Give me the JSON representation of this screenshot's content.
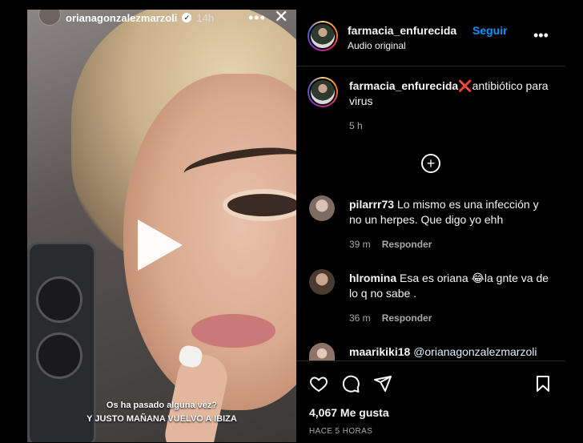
{
  "story": {
    "username": "orianagonzalezmarzoli",
    "time": "14h",
    "caption_line1": "Os ha pasado alguna vez?",
    "caption_line2": "Y JUSTO MAÑANA VUELVO A IBIZA"
  },
  "header": {
    "username": "farmacia_enfurecida",
    "follow": "Seguir",
    "audio": "Audio original"
  },
  "post": {
    "username": "farmacia_enfurecida",
    "cross": "❌",
    "caption": "antibiótico para virus",
    "time": "5 h"
  },
  "comments": [
    {
      "user": "pilarrr73",
      "text": "Lo mismo es una infección y no un herpes. Que digo yo ehh",
      "time": "39 m",
      "reply": "Responder"
    },
    {
      "user": "hlromina",
      "text": "Esa es oriana 😂la gnte va de lo q no sabe .",
      "time": "36 m",
      "reply": "Responder"
    },
    {
      "user": "maarikiki18",
      "text": "@orianagonzalezmarzoli"
    }
  ],
  "footer": {
    "likes": "4,067 Me gusta",
    "ago": "HACE 5 HORAS"
  },
  "icons": {
    "like": "heart-icon",
    "comment": "comment-icon",
    "share": "send-icon",
    "save": "bookmark-icon",
    "play": "play-icon",
    "close": "close-icon",
    "more": "more-icon",
    "load_more": "plus-circle-icon"
  },
  "colors": {
    "accent": "#0095f6",
    "background": "#000000",
    "muted": "#a8a8a8"
  }
}
